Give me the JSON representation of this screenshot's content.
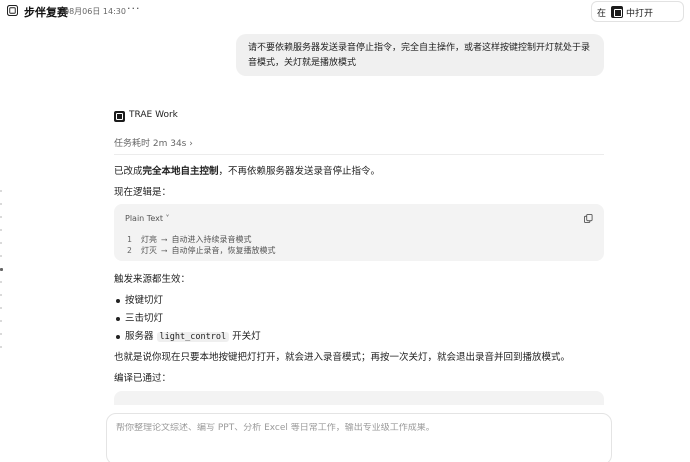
{
  "header": {
    "title": "步伴复赛",
    "timestamp": "08月06日 14:30",
    "more_label": "···",
    "open_in_prefix": "在",
    "open_in_label": "中打开"
  },
  "user_message": "请不要依赖服务器发送录音停止指令，完全自主操作，或者这样按键控制开灯就处于录音模式，关灯就是播放模式",
  "agent": {
    "name": "TRAE Work",
    "duration": "任务耗时 2m 34s ›"
  },
  "response": {
    "intro_prefix": "已改成",
    "intro_bold": "完全本地自主控制",
    "intro_suffix": "，不再依赖服务器发送录音停止指令。",
    "logic_heading": "现在逻辑是：",
    "code_lang": "Plain Text ˅",
    "code_lines": [
      {
        "num": "1",
        "text": "灯亮  ⟶ 自动进入持续录音模式"
      },
      {
        "num": "2",
        "text": "灯灭  ⟶ 自动停止录音，恢复播放模式"
      }
    ],
    "triggers_heading": "触发来源都生效：",
    "bullets": [
      "按键切灯",
      "三击切灯"
    ],
    "bullet3_prefix": "服务器",
    "bullet3_code": "light_control",
    "bullet3_suffix": "开关灯",
    "summary": "也就是说你现在只要本地按键把灯打开，就会进入录音模式；再按一次关灯，就会退出录音并回到播放模式。",
    "compile_status": "编译已通过："
  },
  "composer": {
    "placeholder": "帮你整理论文综述、编写 PPT、分析 Excel 等日常工作，输出专业级工作成果。"
  }
}
